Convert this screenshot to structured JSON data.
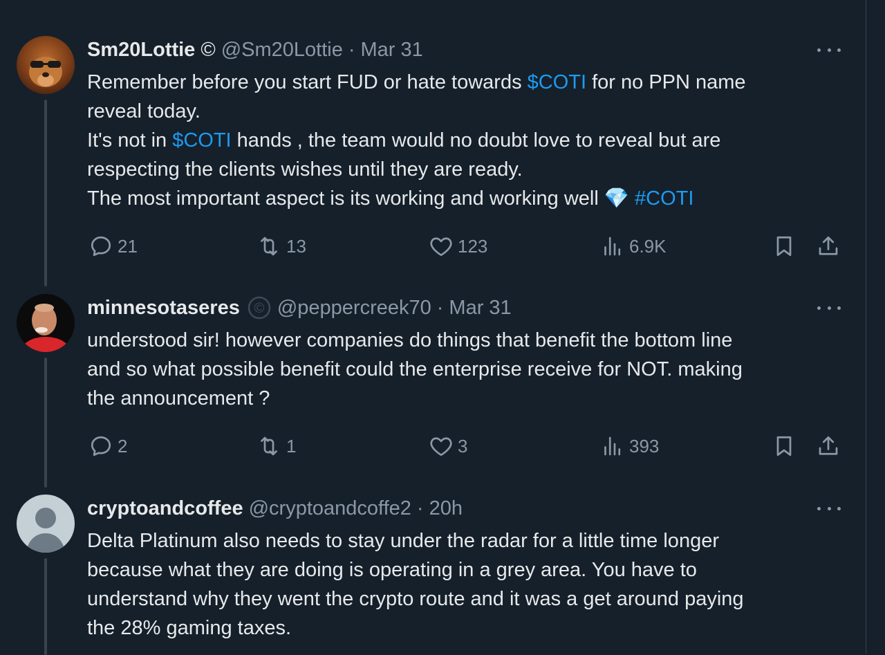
{
  "tweets": [
    {
      "name": "Sm20Lottie",
      "badge": "©",
      "handle": "@Sm20Lottie",
      "separator": "·",
      "time": "Mar 31",
      "lines": [
        [
          {
            "t": "Remember before you start FUD or hate towards "
          },
          {
            "t": "$COTI",
            "link": true
          },
          {
            "t": " for no PPN name"
          }
        ],
        [
          {
            "t": "reveal today."
          }
        ],
        [
          {
            "t": "It's not in "
          },
          {
            "t": "$COTI",
            "link": true
          },
          {
            "t": " hands , the team would no doubt love to reveal but are"
          }
        ],
        [
          {
            "t": "respecting the clients wishes until they are ready."
          }
        ],
        [
          {
            "t": "The most important aspect is its working and working well "
          },
          {
            "t": "💎",
            "emoji": true
          },
          {
            "t": " "
          },
          {
            "t": "#COTI",
            "link": true
          }
        ]
      ],
      "replies": "21",
      "retweets": "13",
      "likes": "123",
      "views": "6.9K"
    },
    {
      "name": "minnesotaseres",
      "badge": "©",
      "handle": "@peppercreek70",
      "separator": "·",
      "time": "Mar 31",
      "lines": [
        [
          {
            "t": "understood sir! however companies do things that benefit the bottom line"
          }
        ],
        [
          {
            "t": "and so what possible benefit could the enterprise receive for NOT. making"
          }
        ],
        [
          {
            "t": "the announcement ?"
          }
        ]
      ],
      "replies": "2",
      "retweets": "1",
      "likes": "3",
      "views": "393"
    },
    {
      "name": "cryptoandcoffee",
      "handle": "@cryptoandcoffe2",
      "separator": "·",
      "time": "20h",
      "lines": [
        [
          {
            "t": "Delta Platinum also needs to stay under the radar for a little time longer"
          }
        ],
        [
          {
            "t": "because what they are doing is operating in a grey area. You have to"
          }
        ],
        [
          {
            "t": "understand why they went the crypto route and it was a get around paying"
          }
        ],
        [
          {
            "t": "the 28% gaming taxes."
          }
        ]
      ]
    }
  ],
  "colors": {
    "background": "#15202b",
    "text": "#e7e9ea",
    "muted": "#8b98a5",
    "link": "#1d9bf0",
    "thread_line": "#38444d"
  },
  "icons": [
    "reply-icon",
    "retweet-icon",
    "like-icon",
    "views-icon",
    "bookmark-icon",
    "share-icon",
    "more-icon"
  ]
}
